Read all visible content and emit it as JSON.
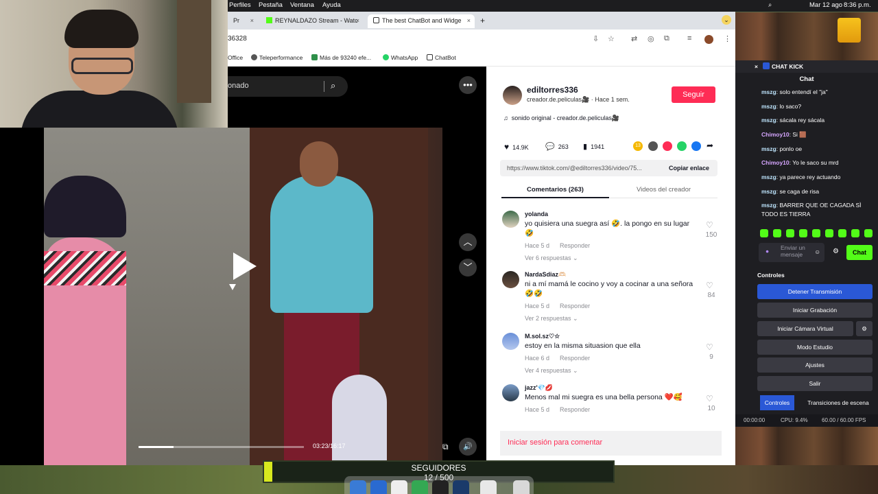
{
  "menubar": {
    "items": [
      "Perfiles",
      "Pestaña",
      "Ventana",
      "Ayuda"
    ],
    "date": "Mar 12 ago",
    "time": "8:36 p.m."
  },
  "browser": {
    "tabs": [
      {
        "label": "Pr",
        "active": false
      },
      {
        "label": "REYNALDAZO Stream - Watc",
        "active": false
      },
      {
        "label": "The best ChatBot and Widge",
        "active": true
      }
    ],
    "url_fragment": "36328",
    "bookmarks": [
      "Office",
      "Teleperformance",
      "Más de 93240 efe...",
      "WhatsApp",
      "ChatBot"
    ]
  },
  "video": {
    "search_text": "onado",
    "time": "03:23/16:17",
    "progress": 0.21
  },
  "creator": {
    "username": "ediltorres336",
    "handle": "creador.de.peliculas🎥",
    "time_ago": "Hace 1 sem.",
    "follow_label": "Seguir",
    "sound": "sonido original - creador.de.peliculas🎥"
  },
  "stats": {
    "likes": "14.9K",
    "comments": "263",
    "saves": "1941",
    "share_count": "13"
  },
  "link": {
    "url": "https://www.tiktok.com/@ediltorres336/video/75...",
    "copy_label": "Copiar enlace"
  },
  "tabs": {
    "comments": "Comentarios (263)",
    "videos": "Videos del creador"
  },
  "comments": [
    {
      "name": "yolanda",
      "text": "yo quisiera una suegra así 🤣. la pongo en su lugar 🤣",
      "date": "Hace 5 d",
      "reply": "Responder",
      "more": "Ver 6 respuestas",
      "likes": "150"
    },
    {
      "name": "NardaSdiaz🫶🏻",
      "text": "ni a mí mamá le cocino y voy a cocinar a una señora 🤣🤣",
      "date": "Hace 5 d",
      "reply": "Responder",
      "more": "Ver 2 respuestas",
      "likes": "84"
    },
    {
      "name": "M.sol.sz♡☆",
      "text": "estoy en la misma situasion que ella",
      "date": "Hace 6 d",
      "reply": "Responder",
      "more": "Ver 4 respuestas",
      "likes": "9"
    },
    {
      "name": "jazz'💎💋",
      "text": "Menos mal mi suegra es una bella persona ❤️🥰",
      "date": "Hace 5 d",
      "reply": "Responder",
      "more": "",
      "likes": "10"
    }
  ],
  "login_comment": "Iniciar sesión para comentar",
  "obs": {
    "header": "CHAT KICK",
    "chat_title": "Chat",
    "messages": [
      {
        "user": "mszg",
        "text": "solo entendí el \"ja\"",
        "color": "#bfe6ff"
      },
      {
        "user": "mszg",
        "text": "lo saco?",
        "color": "#bfe6ff"
      },
      {
        "user": "mszg",
        "text": "sácala rey sácala",
        "color": "#bfe6ff"
      },
      {
        "user": "Chimoy10",
        "text": "Si 🟫",
        "color": "#d6a6ff"
      },
      {
        "user": "mszg",
        "text": "ponlo oe",
        "color": "#bfe6ff"
      },
      {
        "user": "Chimoy10",
        "text": "Yo le saco su mrd",
        "color": "#d6a6ff"
      },
      {
        "user": "mszg",
        "text": "ya parece rey actuando",
        "color": "#bfe6ff"
      },
      {
        "user": "mszg",
        "text": "se caga de risa",
        "color": "#bfe6ff"
      },
      {
        "user": "mszg",
        "text": "BARRER QUE OE CAGADA SÌ TODO ES TIERRA",
        "color": "#bfe6ff"
      }
    ],
    "input_placeholder": "Enviar un mensaje",
    "chat_button": "Chat",
    "controls_header": "Controles",
    "controls": [
      "Detener Transmisión",
      "Iniciar Grabación",
      "Iniciar Cámara Virtual",
      "Modo Estudio",
      "Ajustes",
      "Salir"
    ],
    "bottom_tabs": [
      "Controles",
      "Transiciones de escena"
    ],
    "status_time": "00:00:00",
    "status_cpu": "CPU: 9.4%",
    "status_fps": "60.00 / 60.00 FPS"
  },
  "followers": {
    "label": "SEGUIDORES",
    "count": "12 / 500",
    "progress": 0.024
  },
  "colors": {
    "tiktok_red": "#fe2c55",
    "kick_green": "#53fc18",
    "obs_blue": "#2a58d6"
  }
}
